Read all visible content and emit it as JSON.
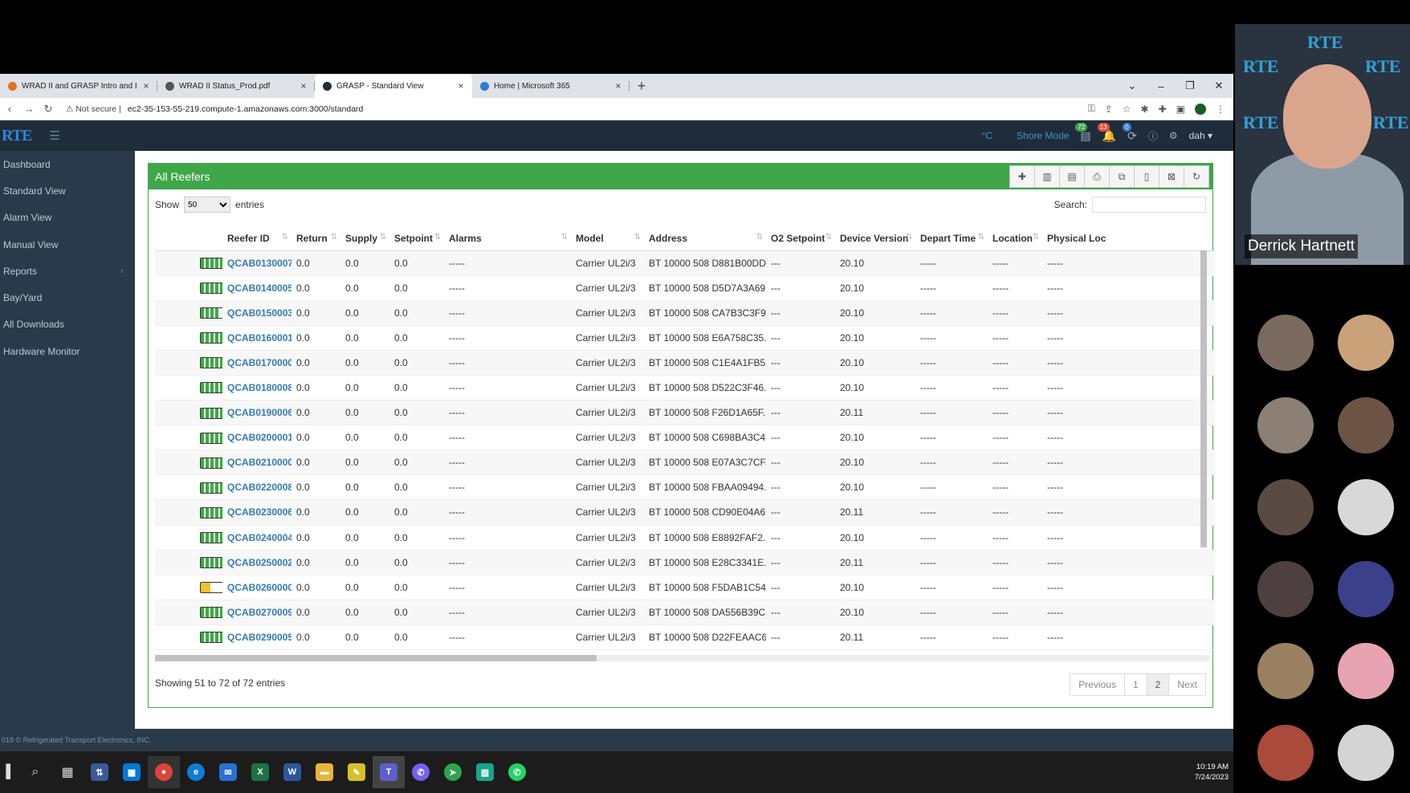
{
  "browser": {
    "tabs": [
      {
        "title": "WRAD II and GRASP Intro and H",
        "active": false,
        "color": "#e8711a"
      },
      {
        "title": "WRAD II Status_Prod.pdf",
        "active": false,
        "color": "#555555"
      },
      {
        "title": "GRASP - Standard View",
        "active": true,
        "color": "#1f2d3b"
      },
      {
        "title": "Home | Microsoft 365",
        "active": false,
        "color": "#2b7cd3"
      }
    ],
    "security_label": "Not secure",
    "url": "ec2-35-153-55-219.compute-1.amazonaws.com:3000/standard"
  },
  "app": {
    "logo": "RTE",
    "header": {
      "temp_unit": "°C",
      "mode": "Shore Mode",
      "badge_green": "72",
      "badge_red": "13",
      "badge_blue": "0",
      "user": "dah"
    },
    "sidebar": [
      {
        "label": "Dashboard"
      },
      {
        "label": "Standard View"
      },
      {
        "label": "Alarm View"
      },
      {
        "label": "Manual View"
      },
      {
        "label": "Reports",
        "chevron": "‹"
      },
      {
        "label": "Bay/Yard"
      },
      {
        "label": "All Downloads"
      },
      {
        "label": "Hardware Monitor"
      }
    ],
    "footer": "018 © Refrigerated Transport Electronics, INC."
  },
  "panel": {
    "title": "All Reefers",
    "show_label": "Show",
    "show_value": "50",
    "entries_label": "entries",
    "search_label": "Search:",
    "columns": [
      "",
      "Reefer ID",
      "Return",
      "Supply",
      "Setpoint",
      "Alarms",
      "Model",
      "Address",
      "O2 Setpoint",
      "Device Version",
      "Depart Time",
      "Location",
      "Physical Loc"
    ],
    "rows": [
      {
        "battery": "full",
        "id": "QCAB0130007",
        "ret": "0.0",
        "sup": "0.0",
        "set": "0.0",
        "alarms": "-----",
        "model": "Carrier UL2i/3",
        "addr": "BT 10000 508 D881B00DD...",
        "o2": "---",
        "ver": "20.10",
        "dep": "-----",
        "loc": "-----",
        "ploc": "-----"
      },
      {
        "battery": "full",
        "id": "QCAB0140005",
        "ret": "0.0",
        "sup": "0.0",
        "set": "0.0",
        "alarms": "-----",
        "model": "Carrier UL2i/3",
        "addr": "BT 10000 508 D5D7A3A69...",
        "o2": "---",
        "ver": "20.10",
        "dep": "-----",
        "loc": "-----",
        "ploc": "-----"
      },
      {
        "battery": "three",
        "id": "QCAB0150003",
        "ret": "0.0",
        "sup": "0.0",
        "set": "0.0",
        "alarms": "-----",
        "model": "Carrier UL2i/3",
        "addr": "BT 10000 508 CA7B3C3F9...",
        "o2": "---",
        "ver": "20.10",
        "dep": "-----",
        "loc": "-----",
        "ploc": "-----"
      },
      {
        "battery": "full",
        "id": "QCAB0160001",
        "ret": "0.0",
        "sup": "0.0",
        "set": "0.0",
        "alarms": "-----",
        "model": "Carrier UL2i/3",
        "addr": "BT 10000 508 E6A758C35...",
        "o2": "---",
        "ver": "20.10",
        "dep": "-----",
        "loc": "-----",
        "ploc": "-----"
      },
      {
        "battery": "full",
        "id": "QCAB0170000",
        "ret": "0.0",
        "sup": "0.0",
        "set": "0.0",
        "alarms": "-----",
        "model": "Carrier UL2i/3",
        "addr": "BT 10000 508 C1E4A1FB5...",
        "o2": "---",
        "ver": "20.10",
        "dep": "-----",
        "loc": "-----",
        "ploc": "-----"
      },
      {
        "battery": "full",
        "id": "QCAB0180008",
        "ret": "0.0",
        "sup": "0.0",
        "set": "0.0",
        "alarms": "-----",
        "model": "Carrier UL2i/3",
        "addr": "BT 10000 508 D522C3F46...",
        "o2": "---",
        "ver": "20.10",
        "dep": "-----",
        "loc": "-----",
        "ploc": "-----"
      },
      {
        "battery": "full",
        "id": "QCAB0190006",
        "ret": "0.0",
        "sup": "0.0",
        "set": "0.0",
        "alarms": "-----",
        "model": "Carrier UL2i/3",
        "addr": "BT 10000 508 F26D1A65F...",
        "o2": "---",
        "ver": "20.11",
        "dep": "-----",
        "loc": "-----",
        "ploc": "-----"
      },
      {
        "battery": "full",
        "id": "QCAB0200001",
        "ret": "0.0",
        "sup": "0.0",
        "set": "0.0",
        "alarms": "-----",
        "model": "Carrier UL2i/3",
        "addr": "BT 10000 508 C698BA3C4...",
        "o2": "---",
        "ver": "20.10",
        "dep": "-----",
        "loc": "-----",
        "ploc": "-----"
      },
      {
        "battery": "full",
        "id": "QCAB0210000",
        "ret": "0.0",
        "sup": "0.0",
        "set": "0.0",
        "alarms": "-----",
        "model": "Carrier UL2i/3",
        "addr": "BT 10000 508 E07A3C7CF...",
        "o2": "---",
        "ver": "20.10",
        "dep": "-----",
        "loc": "-----",
        "ploc": "-----"
      },
      {
        "battery": "full",
        "id": "QCAB0220008",
        "ret": "0.0",
        "sup": "0.0",
        "set": "0.0",
        "alarms": "-----",
        "model": "Carrier UL2i/3",
        "addr": "BT 10000 508 FBAA09494...",
        "o2": "---",
        "ver": "20.10",
        "dep": "-----",
        "loc": "-----",
        "ploc": "-----"
      },
      {
        "battery": "full",
        "id": "QCAB0230006",
        "ret": "0.0",
        "sup": "0.0",
        "set": "0.0",
        "alarms": "-----",
        "model": "Carrier UL2i/3",
        "addr": "BT 10000 508 CD90E04A6...",
        "o2": "---",
        "ver": "20.11",
        "dep": "-----",
        "loc": "-----",
        "ploc": "-----"
      },
      {
        "battery": "full",
        "id": "QCAB0240004",
        "ret": "0.0",
        "sup": "0.0",
        "set": "0.0",
        "alarms": "-----",
        "model": "Carrier UL2i/3",
        "addr": "BT 10000 508 E8892FAF2...",
        "o2": "---",
        "ver": "20.10",
        "dep": "-----",
        "loc": "-----",
        "ploc": "-----"
      },
      {
        "battery": "full",
        "id": "QCAB0250002",
        "ret": "0.0",
        "sup": "0.0",
        "set": "0.0",
        "alarms": "-----",
        "model": "Carrier UL2i/3",
        "addr": "BT 10000 508 E28C3341E...",
        "o2": "---",
        "ver": "20.11",
        "dep": "-----",
        "loc": "-----",
        "ploc": "-----"
      },
      {
        "battery": "half",
        "id": "QCAB0260000",
        "ret": "0.0",
        "sup": "0.0",
        "set": "0.0",
        "alarms": "-----",
        "model": "Carrier UL2i/3",
        "addr": "BT 10000 508 F5DAB1C54...",
        "o2": "---",
        "ver": "20.10",
        "dep": "-----",
        "loc": "-----",
        "ploc": "-----"
      },
      {
        "battery": "full",
        "id": "QCAB0270009",
        "ret": "0.0",
        "sup": "0.0",
        "set": "0.0",
        "alarms": "-----",
        "model": "Carrier UL2i/3",
        "addr": "BT 10000 508 DA556B39C...",
        "o2": "---",
        "ver": "20.10",
        "dep": "-----",
        "loc": "-----",
        "ploc": "-----"
      },
      {
        "battery": "full",
        "id": "QCAB0290005",
        "ret": "0.0",
        "sup": "0.0",
        "set": "0.0",
        "alarms": "-----",
        "model": "Carrier UL2i/3",
        "addr": "BT 10000 508 D22FEAAC6...",
        "o2": "---",
        "ver": "20.11",
        "dep": "-----",
        "loc": "-----",
        "ploc": "-----"
      }
    ],
    "info": "Showing 51 to 72 of 72 entries",
    "pager": {
      "prev": "Previous",
      "p1": "1",
      "p2": "2",
      "next": "Next"
    }
  },
  "taskbar": {
    "time": "10:19 AM",
    "date": "7/24/2023"
  },
  "video": {
    "speaker_name": "Derrick Hartnett",
    "logo_text": "RTE"
  },
  "colors": {
    "green": "#3fa649",
    "link": "#337ab7",
    "sidebar": "#2b3a4a"
  }
}
